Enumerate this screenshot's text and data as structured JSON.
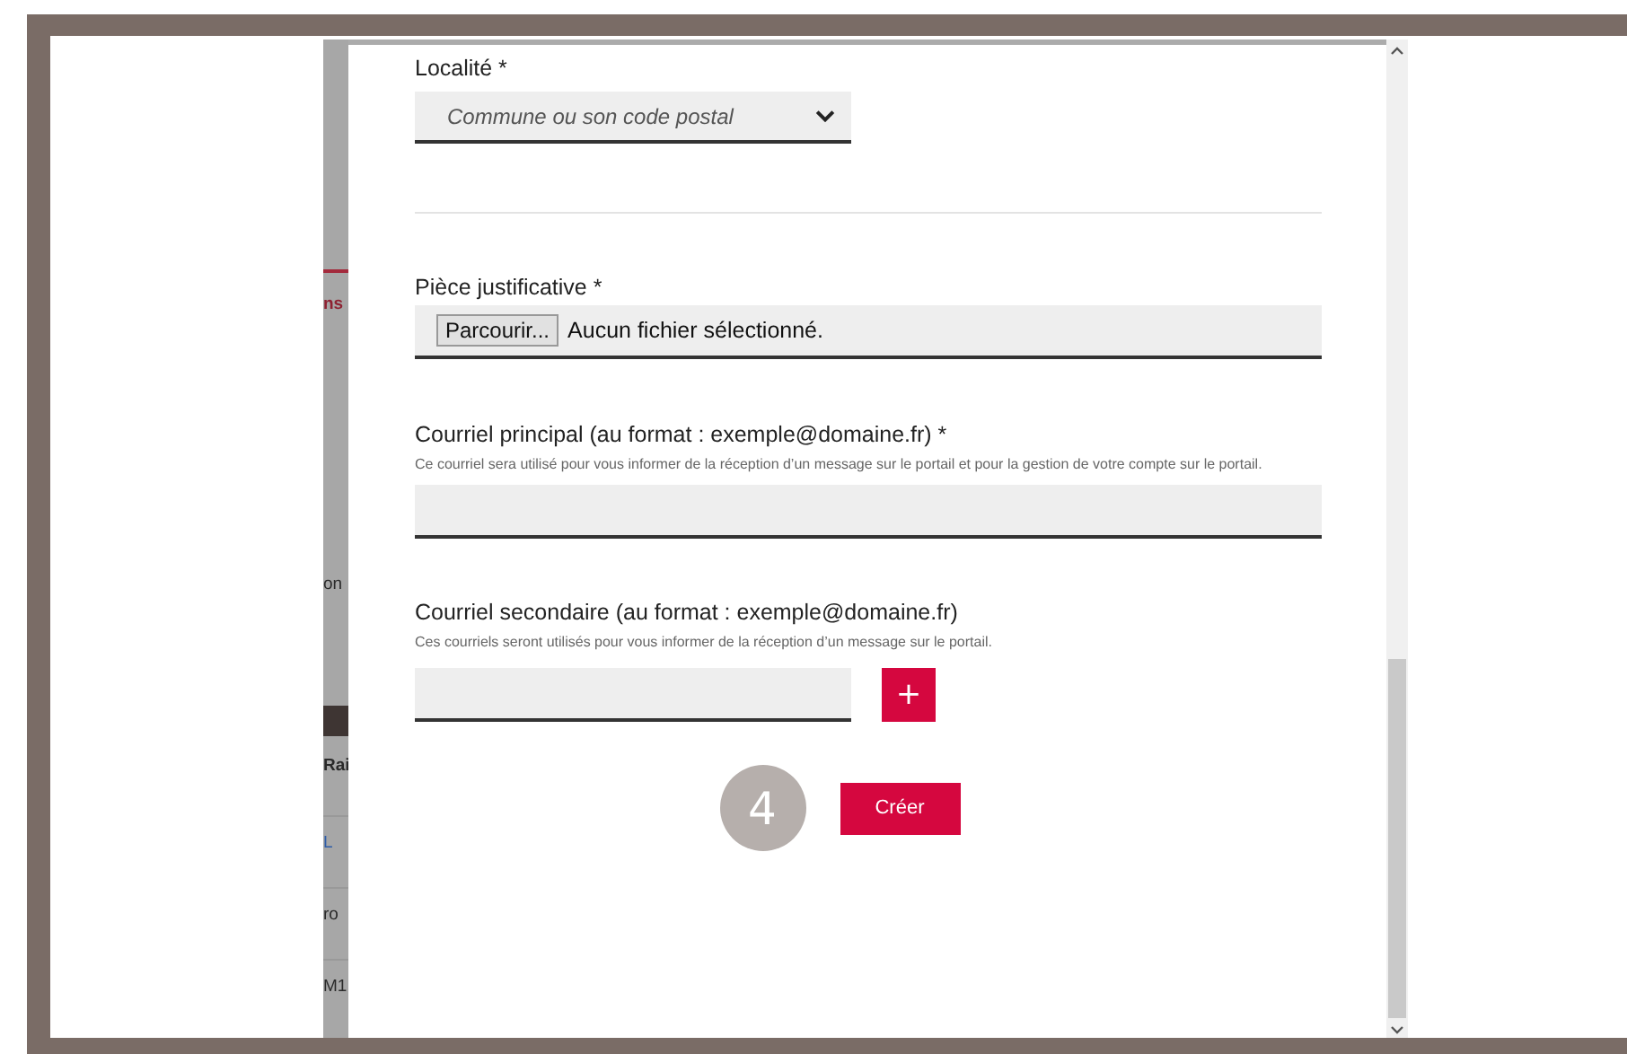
{
  "background_fragments": [
    {
      "text": "ns",
      "kind": "tab"
    },
    {
      "text": "on",
      "kind": "text"
    },
    {
      "text": "Rai",
      "kind": "header"
    },
    {
      "text": "L",
      "kind": "link"
    },
    {
      "text": "ro",
      "kind": "text"
    },
    {
      "text": "M1",
      "kind": "text"
    }
  ],
  "form": {
    "fields": [
      {
        "kind": "select",
        "label": "Localité *",
        "placeholder": "Commune ou son code postal"
      },
      {
        "kind": "file",
        "label": "Pièce justificative *",
        "button": "Parcourir...",
        "value": "Aucun fichier sélectionné."
      },
      {
        "kind": "email",
        "label": "Courriel principal (au format : exemple@domaine.fr) *",
        "help": "Ce courriel sera utilisé pour vous informer de la réception d’un message sur le portail et pour la gestion de votre compte sur le portail."
      },
      {
        "kind": "email_multi",
        "label": "Courriel secondaire (au format : exemple@domaine.fr)",
        "help": "Ces courriels seront utilisés pour vous informer de la réception d’un message sur le portail.",
        "add_button": "+"
      }
    ],
    "step_badge": "4",
    "submit": "Créer"
  }
}
